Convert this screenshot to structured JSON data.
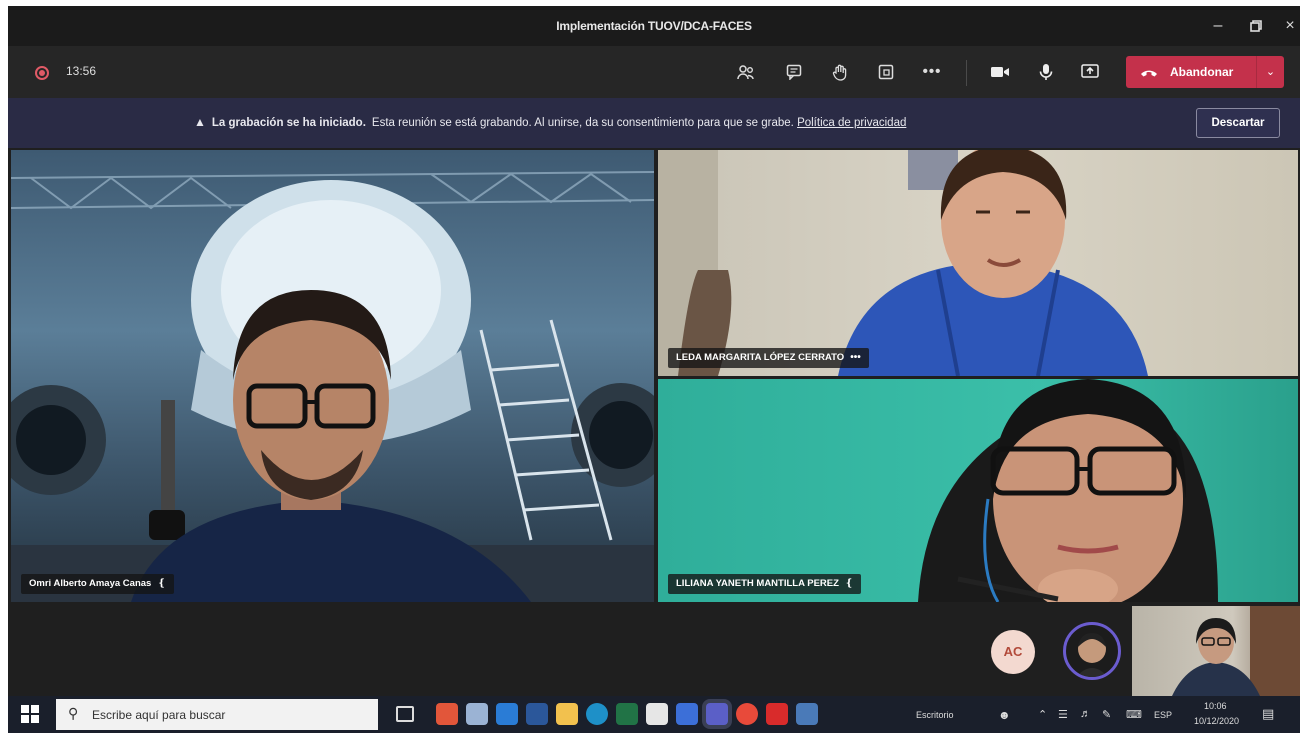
{
  "window": {
    "title": "Implementación TUOV/DCA-FACES"
  },
  "toolbar": {
    "timer": "13:56",
    "leave_label": "Abandonar"
  },
  "banner": {
    "bold": "La grabación se ha iniciado.",
    "text": "Esta reunión se está grabando. Al unirse, da su consentimiento para que se grabe.",
    "link": "Política de privacidad",
    "dismiss": "Descartar"
  },
  "participants": [
    {
      "name": "Omri Alberto Amaya Canas"
    },
    {
      "name": "LEDA MARGARITA LÓPEZ CERRATO",
      "more": "•••"
    },
    {
      "name": "LILIANA YANETH MANTILLA PEREZ"
    }
  ],
  "strip": {
    "avatar_initials": "AC"
  },
  "taskbar": {
    "search_placeholder": "Escribe aquí para buscar",
    "desktop_label": "Escritorio",
    "lang": "ESP",
    "time": "10:06",
    "date": "10/12/2020"
  },
  "colors": {
    "leave": "#c4314b",
    "banner": "#2a2b45",
    "toolbar": "#262626"
  }
}
